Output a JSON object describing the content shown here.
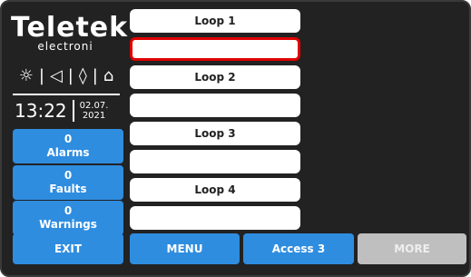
{
  "brand": {
    "name": "Teletek",
    "sub": "electroni"
  },
  "status_icons": [
    "sun-icon",
    "speaker-icon",
    "fire-icon",
    "extinguisher-icon"
  ],
  "icon_glyphs": {
    "sun": "☼",
    "sep": "|",
    "speaker": "◁",
    "fire": "◊",
    "extinguisher": "⌂"
  },
  "clock": {
    "time": "13:22",
    "date_line1": "02.07.",
    "date_line2": "2021"
  },
  "counters": [
    {
      "count": "0",
      "label": "Alarms"
    },
    {
      "count": "0",
      "label": "Faults"
    },
    {
      "count": "0",
      "label": "Warnings"
    }
  ],
  "loops": [
    {
      "label": "Loop 1",
      "value": ""
    },
    {
      "label": "Loop 2",
      "value": ""
    },
    {
      "label": "Loop 3",
      "value": ""
    },
    {
      "label": "Loop 4",
      "value": ""
    }
  ],
  "buttons": {
    "exit": "EXIT",
    "menu": "MENU",
    "access": "Access 3",
    "more": "MORE"
  },
  "colors": {
    "accent": "#2f8de0",
    "selection": "#e00000",
    "panel": "#222222",
    "disabled": "#bfbfbf"
  }
}
